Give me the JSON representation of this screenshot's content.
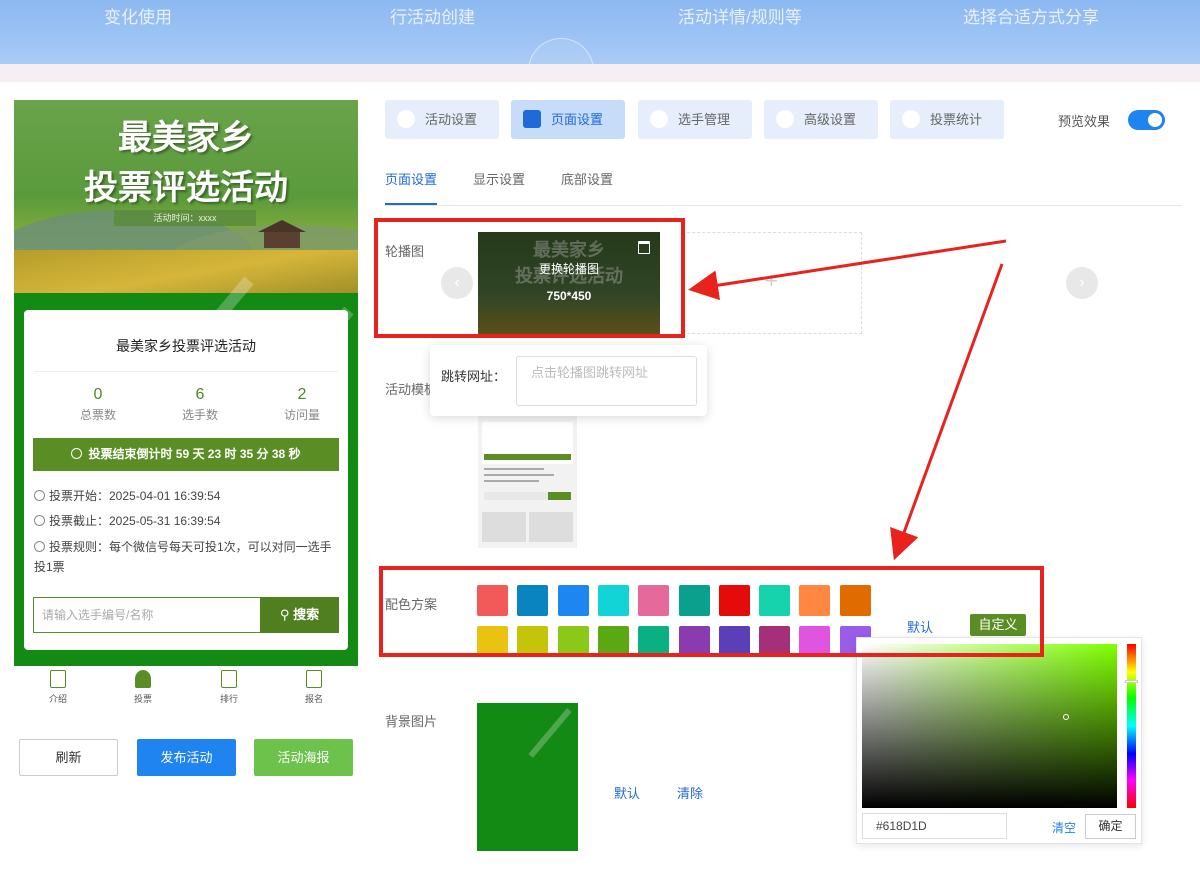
{
  "banner": {
    "captions": [
      "变化使用",
      "行活动创建",
      "活动详情/规则等",
      "选择合适方式分享"
    ]
  },
  "phone": {
    "banner_title_1": "最美家乡",
    "banner_title_2": "投票评选活动",
    "banner_time": "活动时间：xxxx",
    "activity_title": "最美家乡投票评选活动",
    "stats": [
      {
        "value": "0",
        "label": "总票数"
      },
      {
        "value": "6",
        "label": "选手数"
      },
      {
        "value": "2",
        "label": "访问量"
      }
    ],
    "countdown": "投票结束倒计时 59 天 23 时 35 分 38 秒",
    "vote_start": "投票开始：2025-04-01 16:39:54",
    "vote_end": "投票截止：2025-05-31 16:39:54",
    "vote_rule": "投票规则：每个微信号每天可投1次，可以对同一选手投1票",
    "search_placeholder": "请输入选手编号/名称",
    "search_button": "搜索",
    "tabs": [
      {
        "label": "介绍"
      },
      {
        "label": "投票"
      },
      {
        "label": "排行"
      },
      {
        "label": "报名"
      }
    ]
  },
  "actions": {
    "refresh": "刷新",
    "publish": "发布活动",
    "poster": "活动海报"
  },
  "settings": {
    "top_tabs": [
      {
        "label": "活动设置",
        "active": false
      },
      {
        "label": "页面设置",
        "active": true
      },
      {
        "label": "选手管理",
        "active": false
      },
      {
        "label": "高级设置",
        "active": false
      },
      {
        "label": "投票统计",
        "active": false
      }
    ],
    "preview_label": "预览效果",
    "preview_on": true,
    "sub_tabs": [
      {
        "label": "页面设置",
        "active": true
      },
      {
        "label": "显示设置",
        "active": false
      },
      {
        "label": "底部设置",
        "active": false
      }
    ],
    "carousel_label": "轮播图",
    "carousel_thumb_line_1": "最美家乡",
    "carousel_thumb_line_2": "投票评选活动",
    "carousel_change": "更换轮播图",
    "carousel_size": "750*450",
    "link_label": "跳转网址：",
    "link_placeholder": "点击轮播图跳转网址",
    "template_label": "活动模板",
    "color_label": "配色方案",
    "colors_row1": [
      "#f25a5a",
      "#0a84c0",
      "#1e86f0",
      "#12d3d6",
      "#e5699a",
      "#0aa08e",
      "#e50b0b",
      "#17d3ad",
      "#ff8740",
      "#e06b00"
    ],
    "colors_row2": [
      "#e9c212",
      "#c4c40a",
      "#8ac918",
      "#5aa912",
      "#0ab081",
      "#8a3bb0",
      "#5a3fb9",
      "#a5307a",
      "#e055e0",
      "#9a5de8"
    ],
    "color_default": "默认",
    "color_custom": "自定义",
    "bg_label": "背景图片",
    "bg_default": "默认",
    "bg_clear": "清除"
  },
  "color_picker": {
    "hex_value": "#618D1D",
    "clear": "清空",
    "confirm": "确定"
  },
  "colors": {
    "accent": "#1f83f0",
    "theme_green": "#5a8e25",
    "annotation_red": "#e8231d"
  }
}
